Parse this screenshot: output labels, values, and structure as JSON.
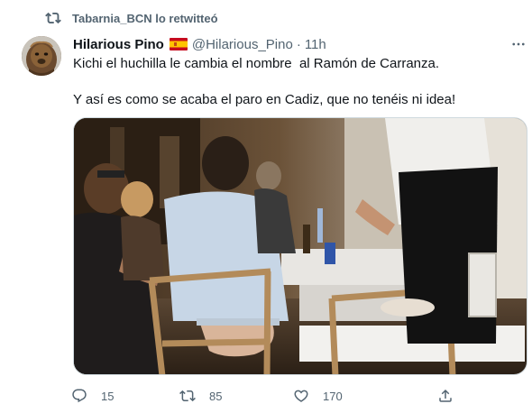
{
  "retweet_header": {
    "text": "Tabarnia_BCN lo retwitteó",
    "icon": "retweet-icon"
  },
  "author": {
    "display_name": "Hilarious Pino",
    "flag": "spain-flag-icon",
    "handle": "@Hilarious_Pino",
    "separator": "·",
    "time": "11h",
    "avatar": "avatar-chewbacca"
  },
  "tweet": {
    "line1": "Kichi el huchilla le cambia el nombre  al Ramón de Carranza.",
    "line2": "Y así es como se acaba el paro en Cadiz, que no tenéis ni idea!"
  },
  "media": {
    "type": "photo",
    "icon": "photo-restaurant-scene"
  },
  "actions": {
    "reply": {
      "icon": "reply-icon",
      "count": "15"
    },
    "retweet": {
      "icon": "retweet-icon",
      "count": "85"
    },
    "like": {
      "icon": "heart-icon",
      "count": "170"
    },
    "share": {
      "icon": "share-icon"
    }
  },
  "more_icon": "more-icon",
  "colors": {
    "text_primary": "#0f1419",
    "text_secondary": "#536471",
    "border": "#cfd9de",
    "background": "#ffffff"
  }
}
